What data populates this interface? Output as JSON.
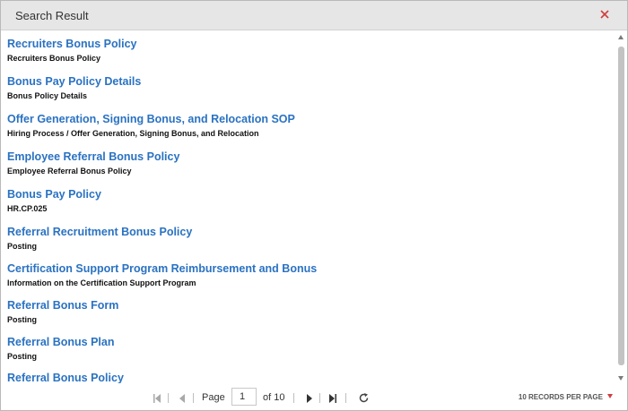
{
  "dialog": {
    "title": "Search Result",
    "close_icon": "close-icon",
    "close_color": "#d23c3c"
  },
  "results": [
    {
      "title": "Recruiters Bonus Policy",
      "description": "Recruiters Bonus Policy"
    },
    {
      "title": "Bonus Pay Policy Details",
      "description": "Bonus Policy Details"
    },
    {
      "title": "Offer Generation, Signing Bonus, and Relocation SOP",
      "description": "Hiring Process / Offer Generation, Signing Bonus, and Relocation"
    },
    {
      "title": "Employee Referral Bonus Policy",
      "description": "Employee Referral Bonus Policy"
    },
    {
      "title": "Bonus Pay Policy",
      "description": "HR.CP.025"
    },
    {
      "title": "Referral Recruitment Bonus Policy",
      "description": "Posting"
    },
    {
      "title": "Certification Support Program Reimbursement and Bonus",
      "description": "Information on the Certification Support Program"
    },
    {
      "title": "Referral Bonus Form",
      "description": "Posting"
    },
    {
      "title": "Referral Bonus Plan",
      "description": "Posting"
    },
    {
      "title": "Referral Bonus Policy",
      "description": ""
    }
  ],
  "pagination": {
    "page_label": "Page",
    "current_page": "1",
    "of_label": "of 10",
    "records_per_page": "10 RECORDS PER PAGE"
  },
  "colors": {
    "link": "#2a72c2",
    "header_bg": "#e6e6e6",
    "accent_red": "#d23c3c"
  }
}
